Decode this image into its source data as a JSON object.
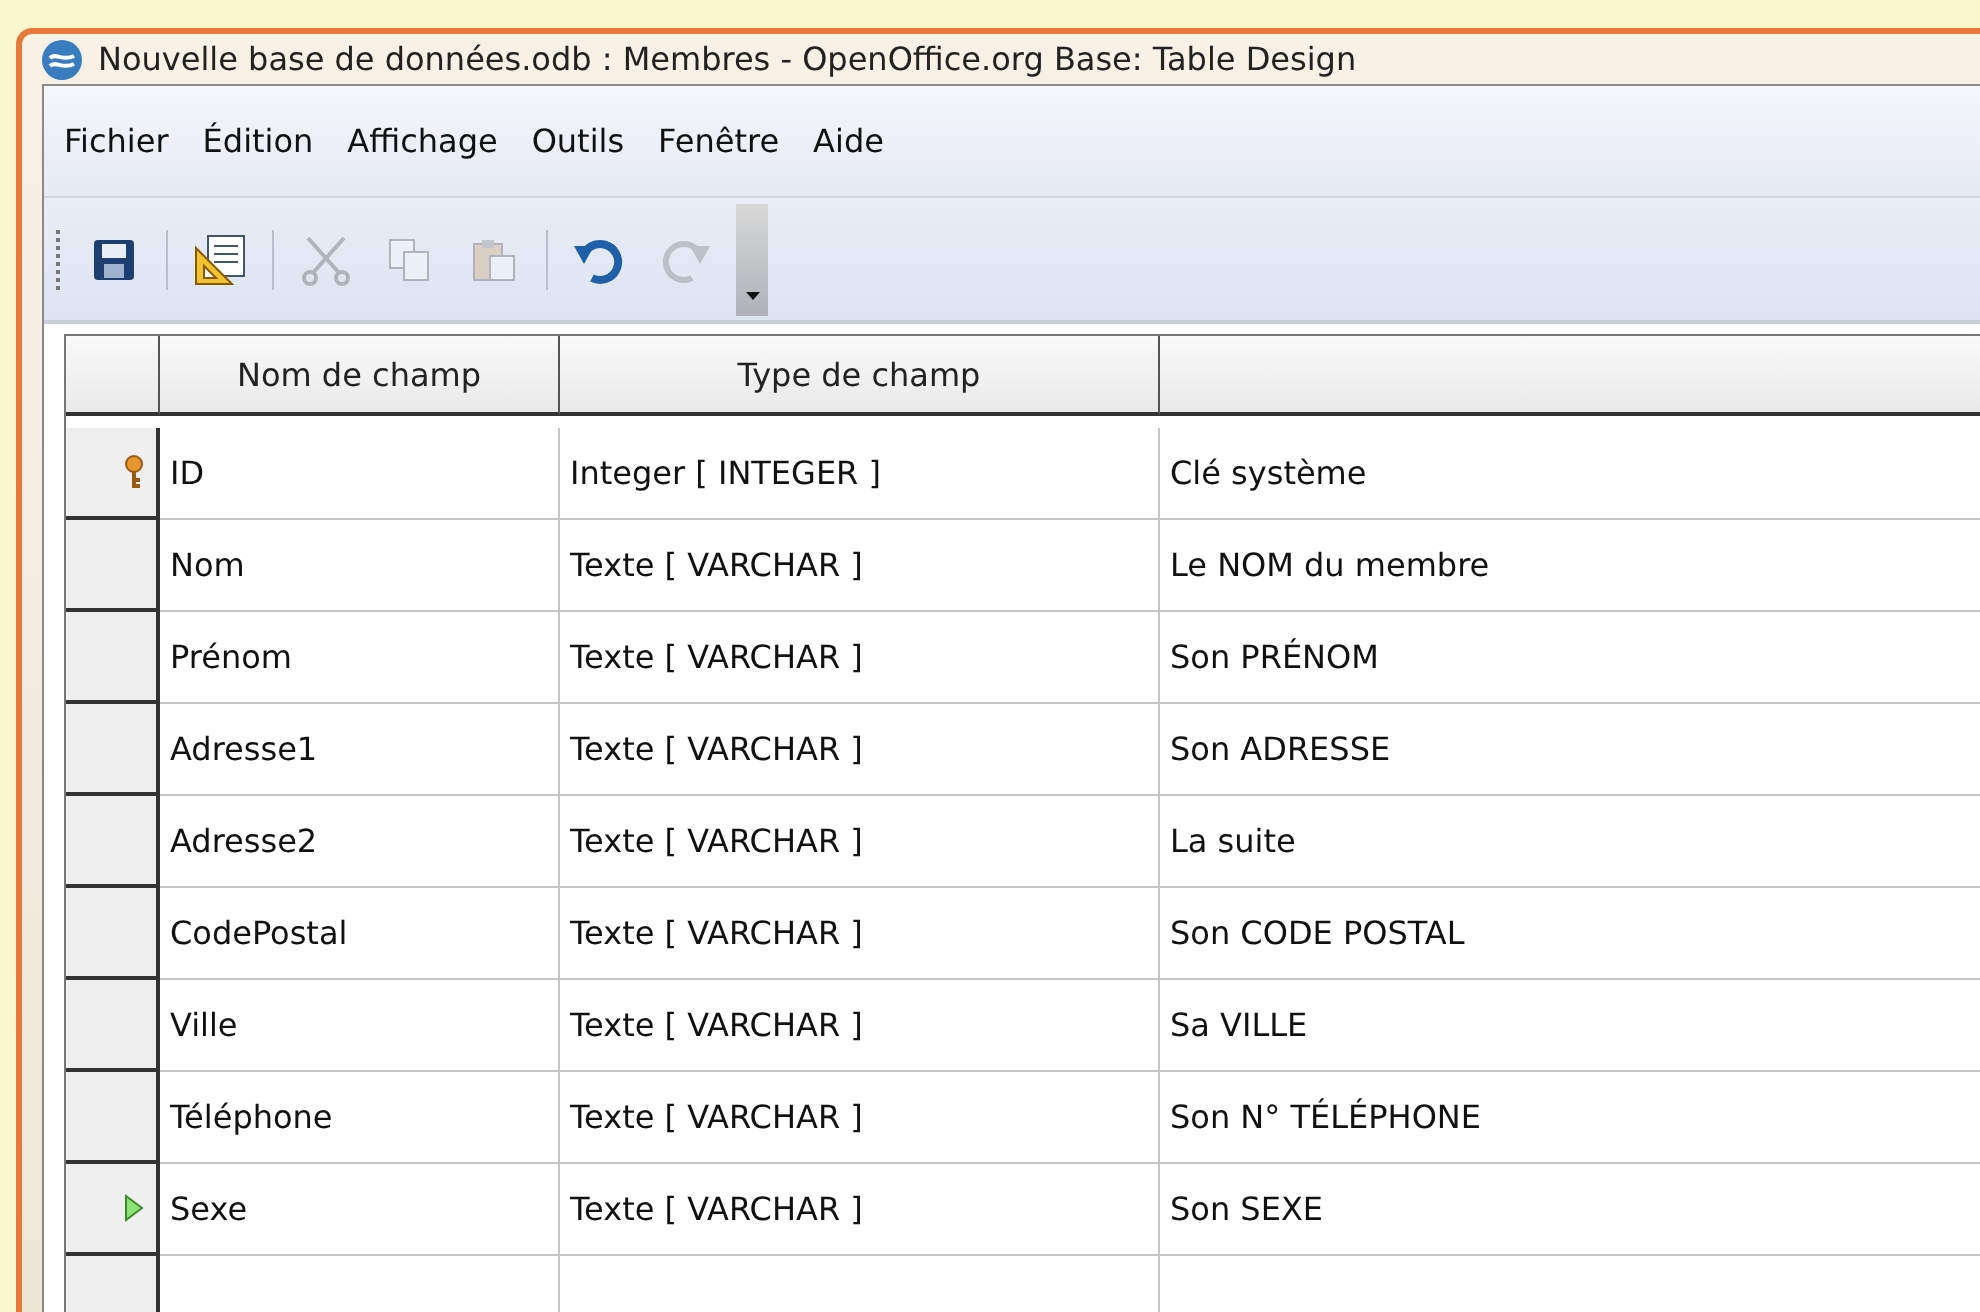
{
  "window": {
    "title": "Nouvelle base de données.odb : Membres - OpenOffice.org Base: Table Design"
  },
  "menu": [
    "Fichier",
    "Édition",
    "Affichage",
    "Outils",
    "Fenêtre",
    "Aide"
  ],
  "toolbar": [
    {
      "kind": "save",
      "disabled": false
    },
    {
      "kind": "separator"
    },
    {
      "kind": "design",
      "disabled": false
    },
    {
      "kind": "separator"
    },
    {
      "kind": "cut",
      "disabled": true
    },
    {
      "kind": "copy",
      "disabled": true
    },
    {
      "kind": "paste",
      "disabled": true
    },
    {
      "kind": "separator"
    },
    {
      "kind": "undo",
      "disabled": false
    },
    {
      "kind": "redo",
      "disabled": true
    },
    {
      "kind": "more",
      "disabled": false
    }
  ],
  "table": {
    "columns": [
      "Nom de champ",
      "Type de champ"
    ],
    "rows": [
      {
        "name": "ID",
        "type": "Integer [ INTEGER ]",
        "description": "Clé système",
        "primary_key": true,
        "selected": false
      },
      {
        "name": "Nom",
        "type": "Texte [ VARCHAR ]",
        "description": "Le NOM du membre",
        "primary_key": false,
        "selected": false
      },
      {
        "name": "Prénom",
        "type": "Texte [ VARCHAR ]",
        "description": "Son PRÉNOM",
        "primary_key": false,
        "selected": false
      },
      {
        "name": "Adresse1",
        "type": "Texte [ VARCHAR ]",
        "description": "Son ADRESSE",
        "primary_key": false,
        "selected": false
      },
      {
        "name": "Adresse2",
        "type": "Texte [ VARCHAR ]",
        "description": "La suite",
        "primary_key": false,
        "selected": false
      },
      {
        "name": "CodePostal",
        "type": "Texte [ VARCHAR ]",
        "description": "Son CODE POSTAL",
        "primary_key": false,
        "selected": false
      },
      {
        "name": "Ville",
        "type": "Texte [ VARCHAR ]",
        "description": "Sa VILLE",
        "primary_key": false,
        "selected": false
      },
      {
        "name": "Téléphone",
        "type": "Texte [ VARCHAR ]",
        "description": "Son N° TÉLÉPHONE",
        "primary_key": false,
        "selected": false
      },
      {
        "name": "Sexe",
        "type": "Texte [ VARCHAR ]",
        "description": "Son SEXE",
        "primary_key": false,
        "selected": true
      }
    ]
  }
}
